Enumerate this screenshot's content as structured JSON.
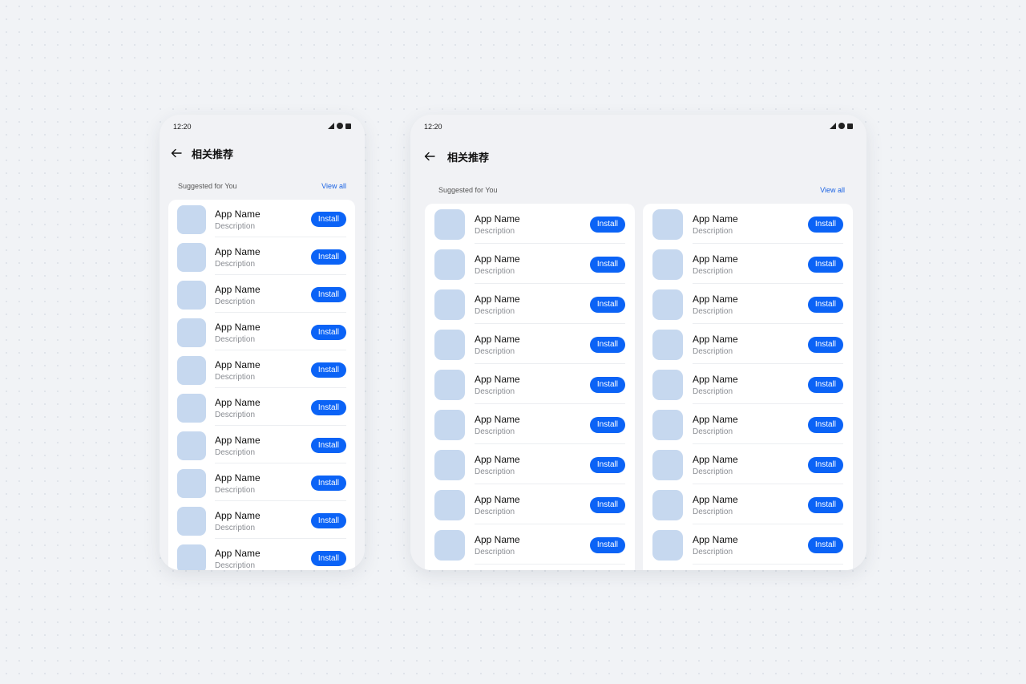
{
  "status": {
    "time": "12:20"
  },
  "header": {
    "title": "相关推荐"
  },
  "section": {
    "title": "Suggested for You",
    "view_all": "View all"
  },
  "item": {
    "name": "App Name",
    "description": "Description",
    "install_label": "Install"
  },
  "icons": [
    "back-arrow-icon",
    "signal-icon",
    "wifi-dot-icon",
    "battery-icon"
  ],
  "colors": {
    "accent": "#0b63f6",
    "link": "#1b63e3",
    "app_icon_placeholder": "#c6d8ef",
    "card": "#ffffff",
    "device_bg": "#f1f2f5"
  },
  "phone": {
    "rows": 10
  },
  "tablet": {
    "rows_per_column": 9,
    "columns": 2
  }
}
